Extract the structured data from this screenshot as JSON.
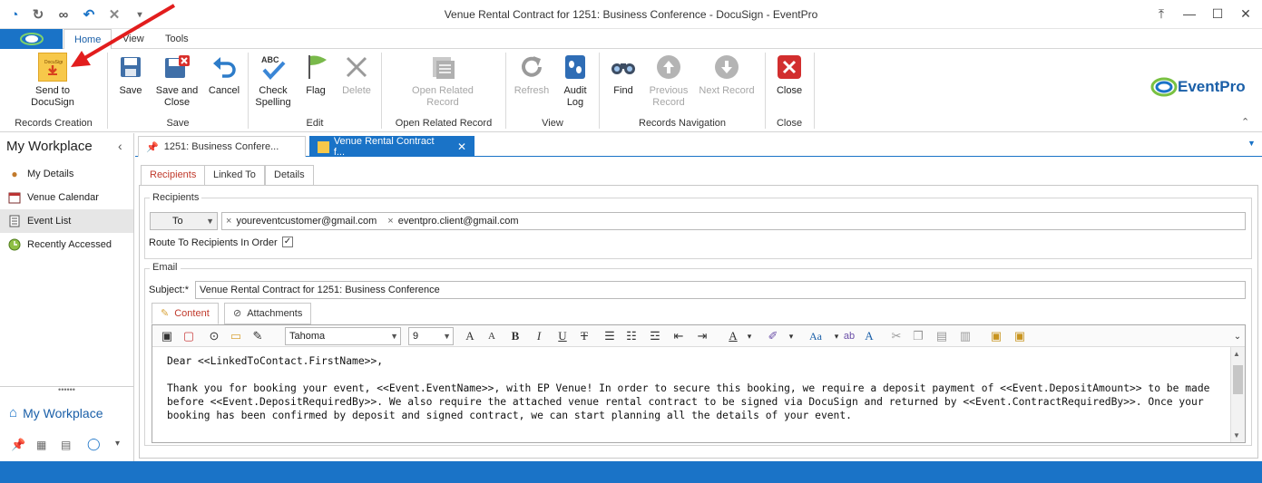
{
  "window": {
    "title": "Venue Rental Contract for 1251: Business Conference - DocuSign - EventPro"
  },
  "menu": {
    "tabs": [
      "Home",
      "View",
      "Tools"
    ]
  },
  "ribbon": {
    "send_docusign": "Send to\nDocuSign",
    "save": "Save",
    "save_close": "Save and\nClose",
    "cancel": "Cancel",
    "check_spelling": "Check\nSpelling",
    "flag": "Flag",
    "delete": "Delete",
    "open_related": "Open Related\nRecord",
    "refresh": "Refresh",
    "audit_log": "Audit\nLog",
    "find": "Find",
    "previous_record": "Previous\nRecord",
    "next_record": "Next Record",
    "close": "Close",
    "groups": {
      "records_creation": "Records Creation",
      "save": "Save",
      "edit": "Edit",
      "open_related": "Open Related Record",
      "view": "View",
      "records_navigation": "Records Navigation",
      "close": "Close"
    },
    "logo_text": "EventPro"
  },
  "sidebar": {
    "title": "My Workplace",
    "items": [
      {
        "label": "My Details",
        "icon": "person-icon"
      },
      {
        "label": "Venue Calendar",
        "icon": "calendar-icon"
      },
      {
        "label": "Event List",
        "icon": "list-icon"
      },
      {
        "label": "Recently Accessed",
        "icon": "clock-icon"
      }
    ],
    "bottom_title": "My Workplace"
  },
  "doc_tabs": [
    {
      "label": "1251: Business Confere..."
    },
    {
      "label": "Venue Rental Contract f..."
    }
  ],
  "sub_tabs": [
    "Recipients",
    "Linked To",
    "Details"
  ],
  "recipients": {
    "group_title": "Recipients",
    "to_label": "To",
    "emails": [
      "youreventcustomer@gmail.com",
      "eventpro.client@gmail.com"
    ],
    "route_label": "Route To Recipients In Order",
    "route_checked": true
  },
  "email": {
    "group_title": "Email",
    "subject_label": "Subject:*",
    "subject_value": "Venue Rental Contract for 1251: Business Conference",
    "tabs": [
      "Content",
      "Attachments"
    ],
    "font_name": "Tahoma",
    "font_size": "9",
    "body_line1": "Dear <<LinkedToContact.FirstName>>,",
    "body_para": "Thank you for booking your event, <<Event.EventName>>, with EP Venue! In order to secure this booking, we require a deposit payment of <<Event.DepositAmount>> to be made before <<Event.DepositRequiredBy>>. We also require the attached venue rental contract to be signed via DocuSign and returned by <<Event.ContractRequiredBy>>. Once your booking has been confirmed by deposit and signed contract, we can start planning all the details of your event."
  },
  "colors": {
    "accent": "#1a73c7",
    "red_arrow": "#e21d1d"
  }
}
